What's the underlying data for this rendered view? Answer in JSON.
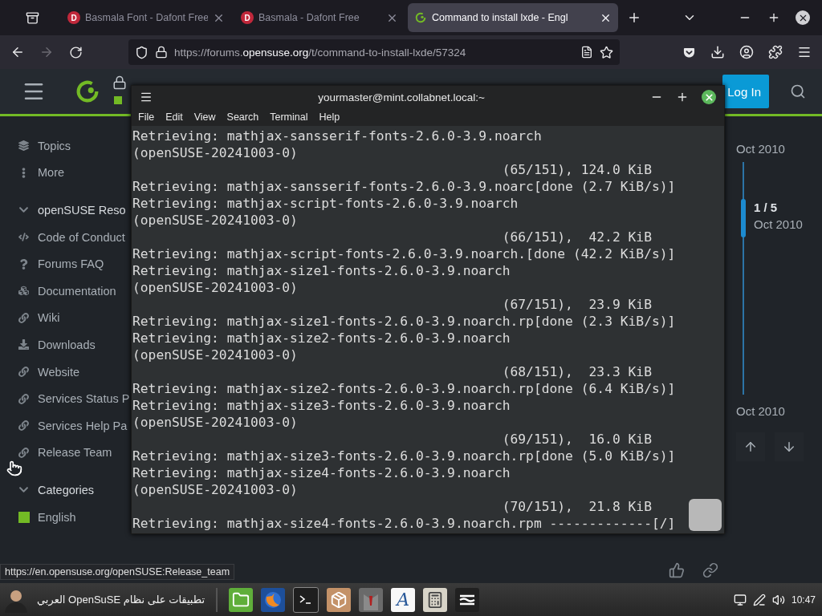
{
  "browser": {
    "tabs": [
      {
        "favicon": "D",
        "title": "Basmala Font - Dafont Free",
        "selected": false
      },
      {
        "favicon": "D",
        "title": "Basmala - Dafont Free",
        "selected": false
      },
      {
        "title": "Command to install lxde - Engl",
        "selected": true
      }
    ],
    "url": {
      "before": "https://forums.",
      "host": "opensuse.org",
      "after": "/t/command-to-install-lxde/57324"
    },
    "forward_disabled": true
  },
  "forum": {
    "login": "Log In",
    "sidebar": [
      {
        "kind": "item",
        "label": "Topics"
      },
      {
        "kind": "item",
        "label": "More"
      },
      {
        "kind": "section",
        "label": "openSUSE Reso",
        "expanded": true
      },
      {
        "kind": "item",
        "label": "Code of Conduct"
      },
      {
        "kind": "item",
        "label": "Forums FAQ"
      },
      {
        "kind": "item",
        "label": "Documentation"
      },
      {
        "kind": "item",
        "label": "Wiki"
      },
      {
        "kind": "item",
        "label": "Downloads"
      },
      {
        "kind": "item",
        "label": "Website"
      },
      {
        "kind": "item",
        "label": "Services Status P"
      },
      {
        "kind": "item",
        "label": "Services Help Pa"
      },
      {
        "kind": "item",
        "label": "Release Team"
      },
      {
        "kind": "section",
        "label": "Categories",
        "expanded": true
      },
      {
        "kind": "category",
        "label": "English",
        "color": "#73ba25"
      }
    ],
    "timeline": {
      "top": "Oct 2010",
      "position": "1 / 5",
      "current": "Oct 2010",
      "bottom": "Oct 2010",
      "level": 0.16
    }
  },
  "terminal": {
    "title": "yourmaster@mint.collabnet.local:~",
    "menu": [
      "File",
      "Edit",
      "View",
      "Search",
      "Terminal",
      "Help"
    ],
    "lines": [
      {
        "kind": "text",
        "text": "Retrieving: mathjax-sansserif-fonts-2.6.0-3.9.noarch"
      },
      {
        "kind": "text",
        "text": "(openSUSE-20241003-0)"
      },
      {
        "kind": "progress",
        "text": "(65/151), 124.0 KiB"
      },
      {
        "kind": "text",
        "text": "Retrieving: mathjax-sansserif-fonts-2.6.0-3.9.noarc[done (2.7 KiB/s)]"
      },
      {
        "kind": "text",
        "text": "Retrieving: mathjax-script-fonts-2.6.0-3.9.noarch"
      },
      {
        "kind": "text",
        "text": "(openSUSE-20241003-0)"
      },
      {
        "kind": "progress",
        "text": "(66/151),  42.2 KiB"
      },
      {
        "kind": "text",
        "text": "Retrieving: mathjax-script-fonts-2.6.0-3.9.noarch.[done (42.2 KiB/s)]"
      },
      {
        "kind": "text",
        "text": "Retrieving: mathjax-size1-fonts-2.6.0-3.9.noarch"
      },
      {
        "kind": "text",
        "text": "(openSUSE-20241003-0)"
      },
      {
        "kind": "progress",
        "text": "(67/151),  23.9 KiB"
      },
      {
        "kind": "text",
        "text": "Retrieving: mathjax-size1-fonts-2.6.0-3.9.noarch.rp[done (2.3 KiB/s)]"
      },
      {
        "kind": "text",
        "text": "Retrieving: mathjax-size2-fonts-2.6.0-3.9.noarch"
      },
      {
        "kind": "text",
        "text": "(openSUSE-20241003-0)"
      },
      {
        "kind": "progress",
        "text": "(68/151),  23.3 KiB"
      },
      {
        "kind": "text",
        "text": "Retrieving: mathjax-size2-fonts-2.6.0-3.9.noarch.rp[done (6.4 KiB/s)]"
      },
      {
        "kind": "text",
        "text": "Retrieving: mathjax-size3-fonts-2.6.0-3.9.noarch"
      },
      {
        "kind": "text",
        "text": "(openSUSE-20241003-0)"
      },
      {
        "kind": "progress",
        "text": "(69/151),  16.0 KiB"
      },
      {
        "kind": "text",
        "text": "Retrieving: mathjax-size3-fonts-2.6.0-3.9.noarch.rp[done (5.0 KiB/s)]"
      },
      {
        "kind": "text",
        "text": "Retrieving: mathjax-size4-fonts-2.6.0-3.9.noarch"
      },
      {
        "kind": "text",
        "text": "(openSUSE-20241003-0)"
      },
      {
        "kind": "progress",
        "text": "(70/151),  21.8 KiB"
      },
      {
        "kind": "text",
        "text": "Retrieving: mathjax-size4-fonts-2.6.0-3.9.noarch.rpm -------------[/]"
      }
    ]
  },
  "status_url": "https://en.opensuse.org/openSUSE:Release_team",
  "taskbar": {
    "menu_label": "تطبيقات على نظام OpenSuSE العربي",
    "font_glyph": "A",
    "clock": "10:47"
  }
}
